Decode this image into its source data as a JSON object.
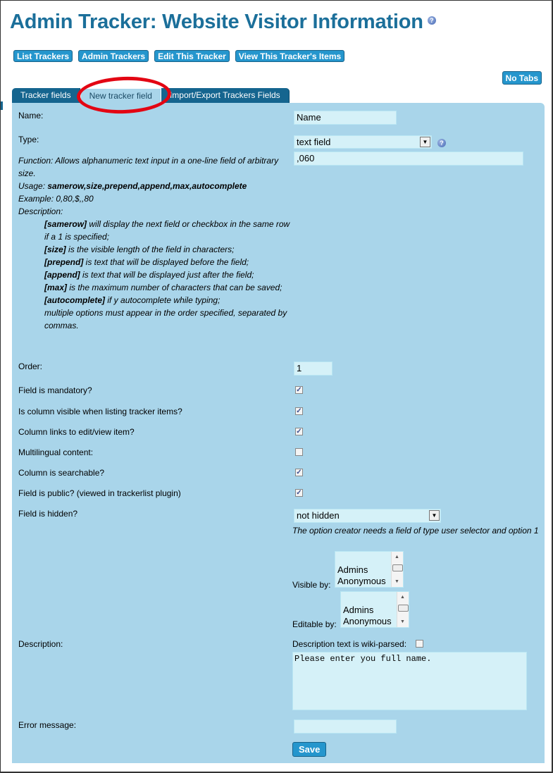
{
  "header": {
    "title": "Admin Tracker: Website Visitor Information",
    "help_icon": "help-icon"
  },
  "top_buttons": {
    "list_trackers": "List Trackers",
    "admin_trackers": "Admin Trackers",
    "edit_tracker": "Edit This Tracker",
    "view_items": "View This Tracker's Items",
    "no_tabs": "No Tabs"
  },
  "tabs": [
    {
      "label": "Tracker fields",
      "active": false
    },
    {
      "label": "New tracker field",
      "active": true
    },
    {
      "label": "Import/Export Trackers Fields",
      "active": false
    }
  ],
  "form": {
    "name_label": "Name:",
    "name_value": "Name",
    "type_label": "Type:",
    "type_value": "text field",
    "options_value": ",060",
    "function_text": "Function: Allows alphanumeric text input in a one-line field of arbitrary size.",
    "usage_prefix": "Usage: ",
    "usage_value": "samerow,size,prepend,append,max,autocomplete",
    "example": "Example: 0,80,$,,80",
    "description_heading": "Description:",
    "params": [
      {
        "name": "[samerow]",
        "text": " will display the next field or checkbox in the same row if a 1 is specified;"
      },
      {
        "name": "[size]",
        "text": " is the visible length of the field in characters;"
      },
      {
        "name": "[prepend]",
        "text": " is text that will be displayed before the field;"
      },
      {
        "name": "[append]",
        "text": " is text that will be displayed just after the field;"
      },
      {
        "name": "[max]",
        "text": " is the maximum number of characters that can be saved;"
      },
      {
        "name": "[autocomplete]",
        "text": " if y autocomplete while typing;"
      }
    ],
    "params_footer": "multiple options must appear in the order specified, separated by commas.",
    "order_label": "Order:",
    "order_value": "1",
    "checkboxes": [
      {
        "label": "Field is mandatory?",
        "checked": true
      },
      {
        "label": "Is column visible when listing tracker items?",
        "checked": true
      },
      {
        "label": "Column links to edit/view item?",
        "checked": true
      },
      {
        "label": "Multilingual content:",
        "checked": false
      },
      {
        "label": "Column is searchable?",
        "checked": true
      },
      {
        "label": "Field is public? (viewed in trackerlist plugin)",
        "checked": true
      }
    ],
    "hidden_label": "Field is hidden?",
    "hidden_value": "not hidden",
    "hidden_note": "The option creator needs a field of type user selector and option 1",
    "visible_by_label": "Visible by:",
    "editable_by_label": "Editable by:",
    "groups": [
      "Admins",
      "Anonymous"
    ],
    "description_label": "Description:",
    "wiki_parsed_label": "Description text is wiki-parsed:",
    "wiki_parsed_checked": false,
    "description_value": "Please enter you full name.",
    "error_label": "Error message:",
    "error_value": "",
    "save_label": "Save"
  },
  "colors": {
    "title": "#1b6f9a",
    "button": "#2596cd",
    "tab": "#15658f",
    "panel": "#a9d5ea",
    "input": "#d5f1f8",
    "annotation_ring": "#e30613"
  }
}
